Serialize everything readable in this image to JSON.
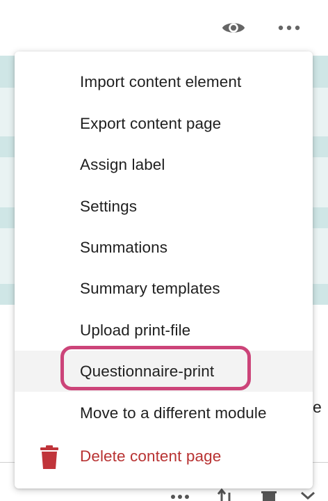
{
  "toolbar": {
    "icons": [
      "eye-icon",
      "more-horizontal-icon"
    ]
  },
  "menu": {
    "items": [
      {
        "label": "Import content element"
      },
      {
        "label": "Export content page"
      },
      {
        "label": "Assign label"
      },
      {
        "label": "Settings"
      },
      {
        "label": "Summations"
      },
      {
        "label": "Summary templates"
      },
      {
        "label": "Upload print-file"
      },
      {
        "label": "Questionnaire-print",
        "highlighted": true
      },
      {
        "label": "Move to a different module"
      },
      {
        "label": "Delete content page",
        "danger": true,
        "icon": "trash-icon"
      }
    ]
  },
  "background": {
    "peek_letter": "e"
  },
  "colors": {
    "accent_ring": "#cc4479",
    "danger": "#b83232",
    "teal_row": "#cfe6e6"
  }
}
